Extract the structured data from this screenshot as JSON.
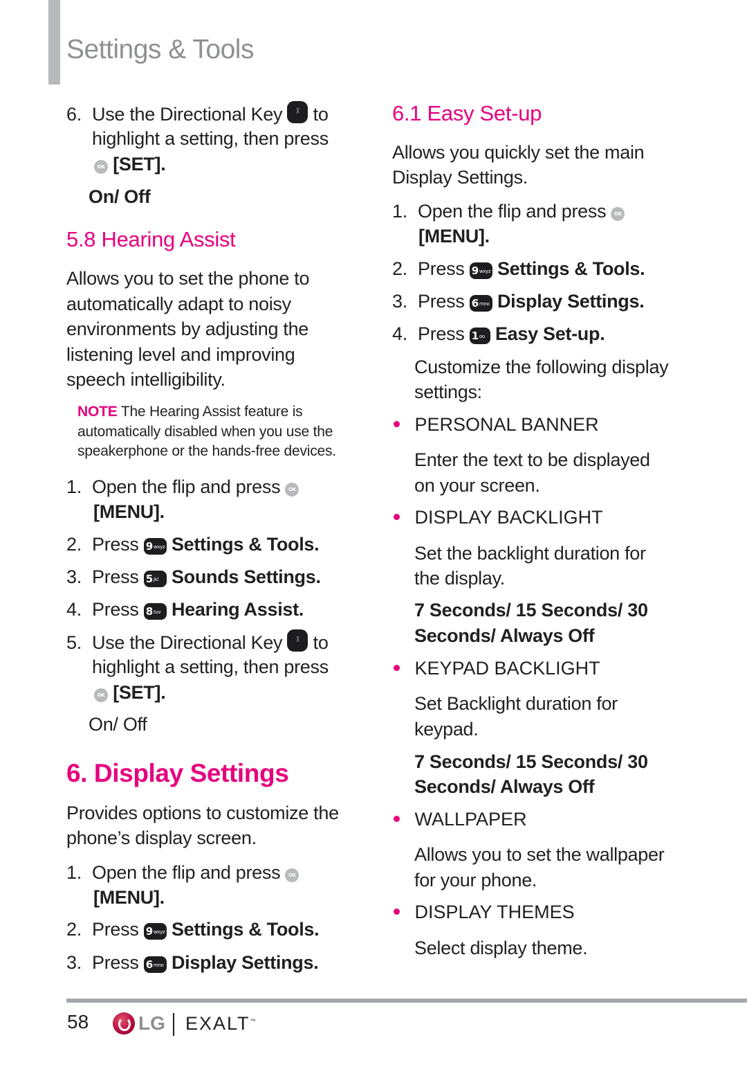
{
  "header": {
    "title": "Settings & Tools"
  },
  "left": {
    "step6": {
      "num": "6.",
      "line1a": "Use the Directional Key",
      "line1b": "to",
      "line2": "highlight a setting, then press",
      "line3": "[SET].",
      "option": "On/ Off"
    },
    "hearing": {
      "heading": "5.8 Hearing Assist",
      "desc": [
        "Allows you to set the phone to",
        "automatically adapt to noisy",
        "environments by adjusting the",
        "listening level and improving",
        "speech intelligibility."
      ],
      "note_label": "NOTE",
      "note": [
        "The Hearing Assist feature is",
        "automatically disabled when you use the",
        "speakerphone or the hands-free devices."
      ],
      "steps": [
        {
          "num": "1.",
          "text": "Open the flip and press",
          "cont": "[MENU]."
        },
        {
          "num": "2.",
          "press": "Press",
          "key": "9",
          "key_sub": "wxyz",
          "target": "Settings & Tools."
        },
        {
          "num": "3.",
          "press": "Press",
          "key": "5",
          "key_sub": "jkl",
          "target": "Sounds Settings."
        },
        {
          "num": "4.",
          "press": "Press",
          "key": "8",
          "key_sub": "tuv",
          "target": "Hearing Assist."
        },
        {
          "num": "5.",
          "line1a": "Use the Directional Key",
          "line1b": "to",
          "line2": "highlight a setting, then press",
          "line3": "[SET].",
          "option": "On/ Off"
        }
      ]
    },
    "display": {
      "heading": "6. Display Settings",
      "desc": [
        "Provides options to customize the",
        "phone’s display screen."
      ],
      "steps": [
        {
          "num": "1.",
          "text": "Open the flip and press",
          "cont": "[MENU]."
        },
        {
          "num": "2.",
          "press": "Press",
          "key": "9",
          "key_sub": "wxyz",
          "target": "Settings & Tools."
        },
        {
          "num": "3.",
          "press": "Press",
          "key": "6",
          "key_sub": "mno",
          "target": "Display Settings."
        }
      ]
    }
  },
  "right": {
    "easy": {
      "heading": "6.1 Easy Set-up",
      "desc": [
        "Allows you quickly set the main",
        "Display Settings."
      ],
      "steps": [
        {
          "num": "1.",
          "text": "Open the flip and press",
          "cont": "[MENU]."
        },
        {
          "num": "2.",
          "press": "Press",
          "key": "9",
          "key_sub": "wxyz",
          "target": "Settings & Tools."
        },
        {
          "num": "3.",
          "press": "Press",
          "key": "6",
          "key_sub": "mno",
          "target": "Display Settings."
        },
        {
          "num": "4.",
          "press": "Press",
          "key": "1",
          "key_sub": "oo",
          "target": "Easy Set-up."
        }
      ],
      "customize": [
        "Customize the following display",
        "settings:"
      ],
      "items": [
        {
          "title": "PERSONAL BANNER",
          "desc": [
            "Enter the text to be displayed",
            "on your screen."
          ]
        },
        {
          "title": "DISPLAY BACKLIGHT",
          "desc": [
            "Set the backlight duration for",
            "the display."
          ],
          "options": [
            "7 Seconds/ 15 Seconds/ 30",
            "Seconds/ Always Off"
          ]
        },
        {
          "title": "KEYPAD BACKLIGHT",
          "desc": [
            "Set Backlight duration for",
            "keypad."
          ],
          "options": [
            "7 Seconds/ 15 Seconds/ 30",
            "Seconds/ Always Off"
          ]
        },
        {
          "title": "WALLPAPER",
          "desc": [
            "Allows you to set the wallpaper",
            "for your phone."
          ]
        },
        {
          "title": "DISPLAY THEMES",
          "desc": [
            "Select display theme."
          ]
        }
      ]
    }
  },
  "icons": {
    "ok_label": "OK"
  },
  "footer": {
    "page": "58",
    "lg": "LG",
    "product": "EXALT",
    "tm": "™"
  },
  "colors": {
    "accent": "#e6007e",
    "header_gray": "#8e9092",
    "bar_gray": "#b8b9bb"
  }
}
